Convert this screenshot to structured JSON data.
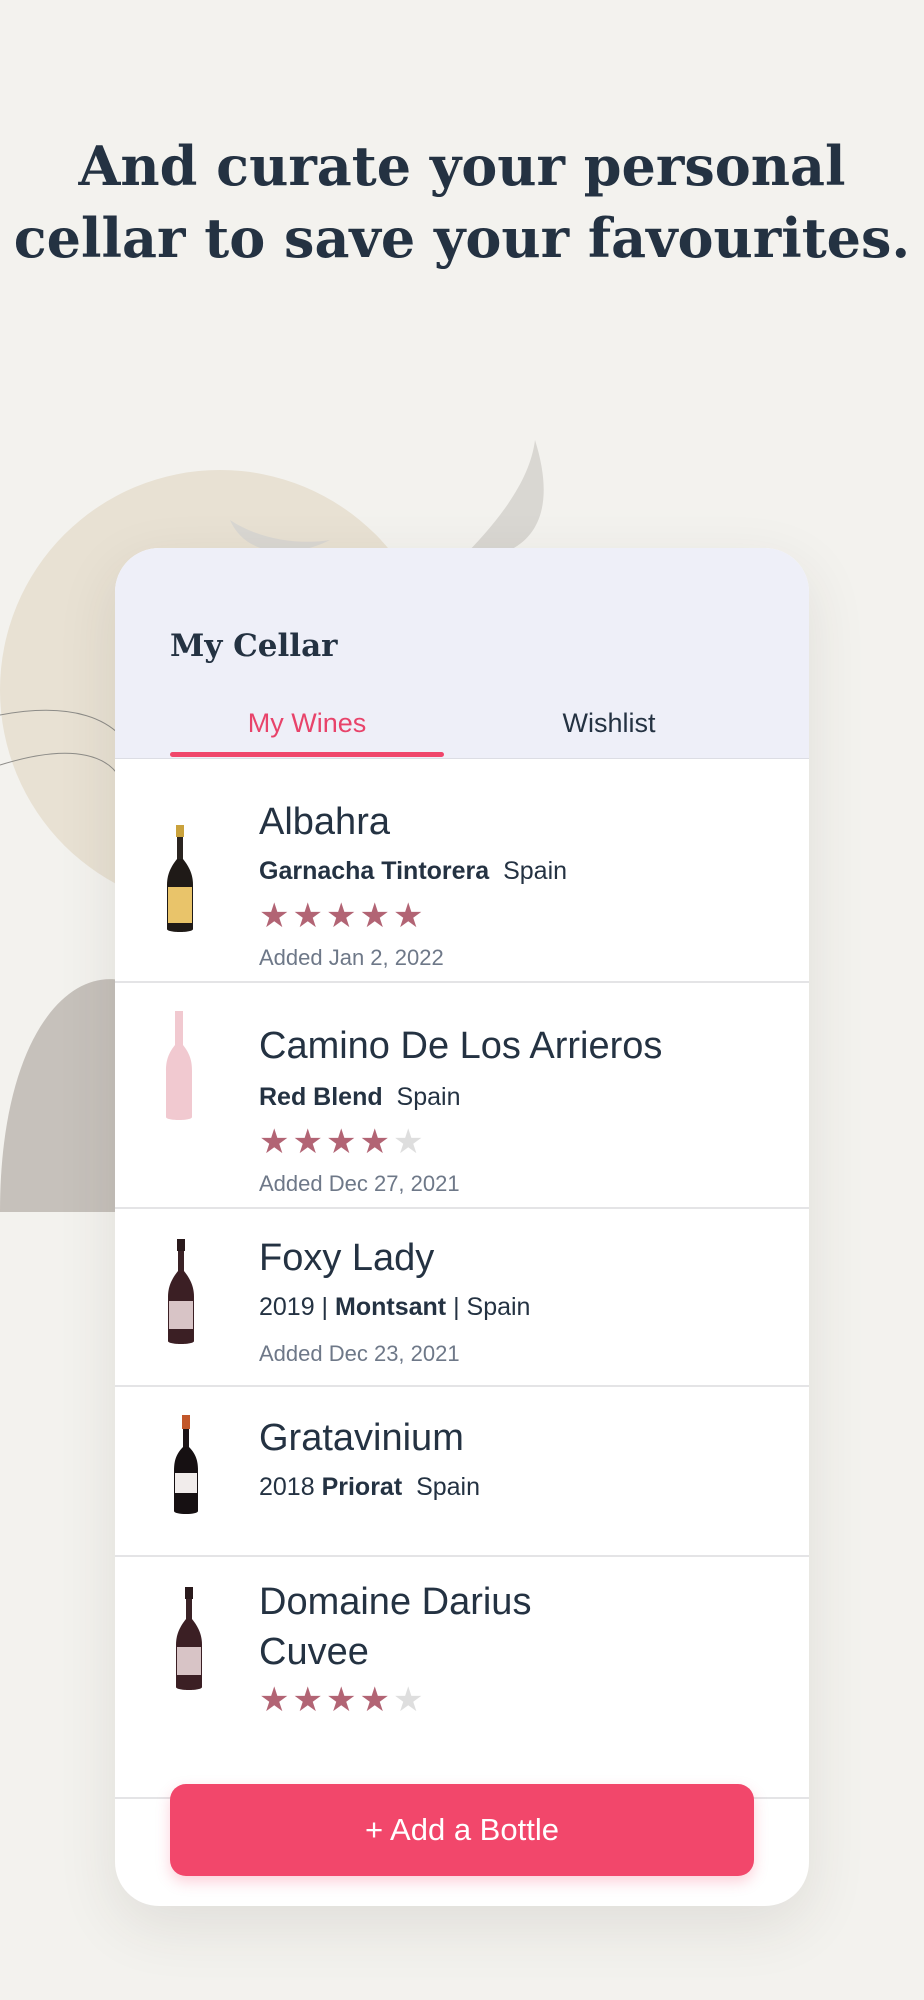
{
  "headline": "And curate your personal cellar to save your favourites.",
  "cellar": {
    "title": "My Cellar",
    "tabs": [
      "My Wines",
      "Wishlist"
    ],
    "active_tab": "My Wines"
  },
  "wines": [
    {
      "name": "Albahra",
      "meta_bold": "Garnacha Tintorera",
      "meta_rest": "Spain",
      "rating": 5,
      "added": "Added Jan 2, 2022",
      "bottle_icon": "wine-bottle-yellow-label-icon"
    },
    {
      "name": "Camino De Los Arrieros",
      "meta_bold": "Red Blend",
      "meta_rest": "Spain",
      "rating": 4,
      "added": "Added Dec 27, 2021",
      "bottle_icon": "wine-bottle-placeholder-icon"
    },
    {
      "name": "Foxy Lady",
      "meta_pre": "2019 |",
      "meta_bold": "Montsant",
      "meta_rest": "| Spain",
      "added": "Added Dec 23, 2021",
      "bottle_icon": "wine-bottle-dark-icon"
    },
    {
      "name": "Gratavinium",
      "meta_pre": "2018",
      "meta_bold": "Priorat",
      "meta_rest": "Spain",
      "bottle_icon": "wine-bottle-dark-icon"
    },
    {
      "name": "Domaine Darius Cuvee",
      "name_line1": "Domaine Darius",
      "name_line2": "Cuvee",
      "rating": 4,
      "bottle_icon": "wine-bottle-dark-icon"
    }
  ],
  "add_button": "+ Add a Bottle",
  "colors": {
    "accent": "#f2476b",
    "star": "#b26474",
    "text": "#243242",
    "header_bg": "#eeeff8",
    "page_bg": "#f3f2ee"
  }
}
